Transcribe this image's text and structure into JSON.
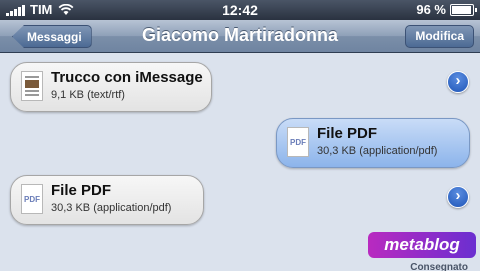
{
  "status_bar": {
    "carrier": "TIM",
    "time": "12:42",
    "battery": "96 %",
    "battery_level": 0.96,
    "icons": [
      "signal-icon",
      "wifi-icon",
      "battery-icon"
    ]
  },
  "nav": {
    "back_label": "Messaggi",
    "title": "Giacomo Martiradonna",
    "edit_label": "Modifica"
  },
  "messages": [
    {
      "direction": "incoming",
      "name": "Trucco con iMessage",
      "size": "9,1 KB (text/rtf)",
      "icon": "rtf-document-icon"
    },
    {
      "direction": "outgoing",
      "name": "File PDF",
      "size": "30,3 KB (application/pdf)",
      "icon_label": "PDF"
    },
    {
      "direction": "incoming",
      "name": "File PDF",
      "size": "30,3 KB (application/pdf)",
      "icon_label": "PDF"
    }
  ],
  "delivered": "Consegnato",
  "watermark": "metablog",
  "colors": {
    "background": "#dbe2ed",
    "outgoing_bubble": "#8cb4eb",
    "disclosure": "#1f56b8",
    "watermark": "#8a2cc8"
  }
}
